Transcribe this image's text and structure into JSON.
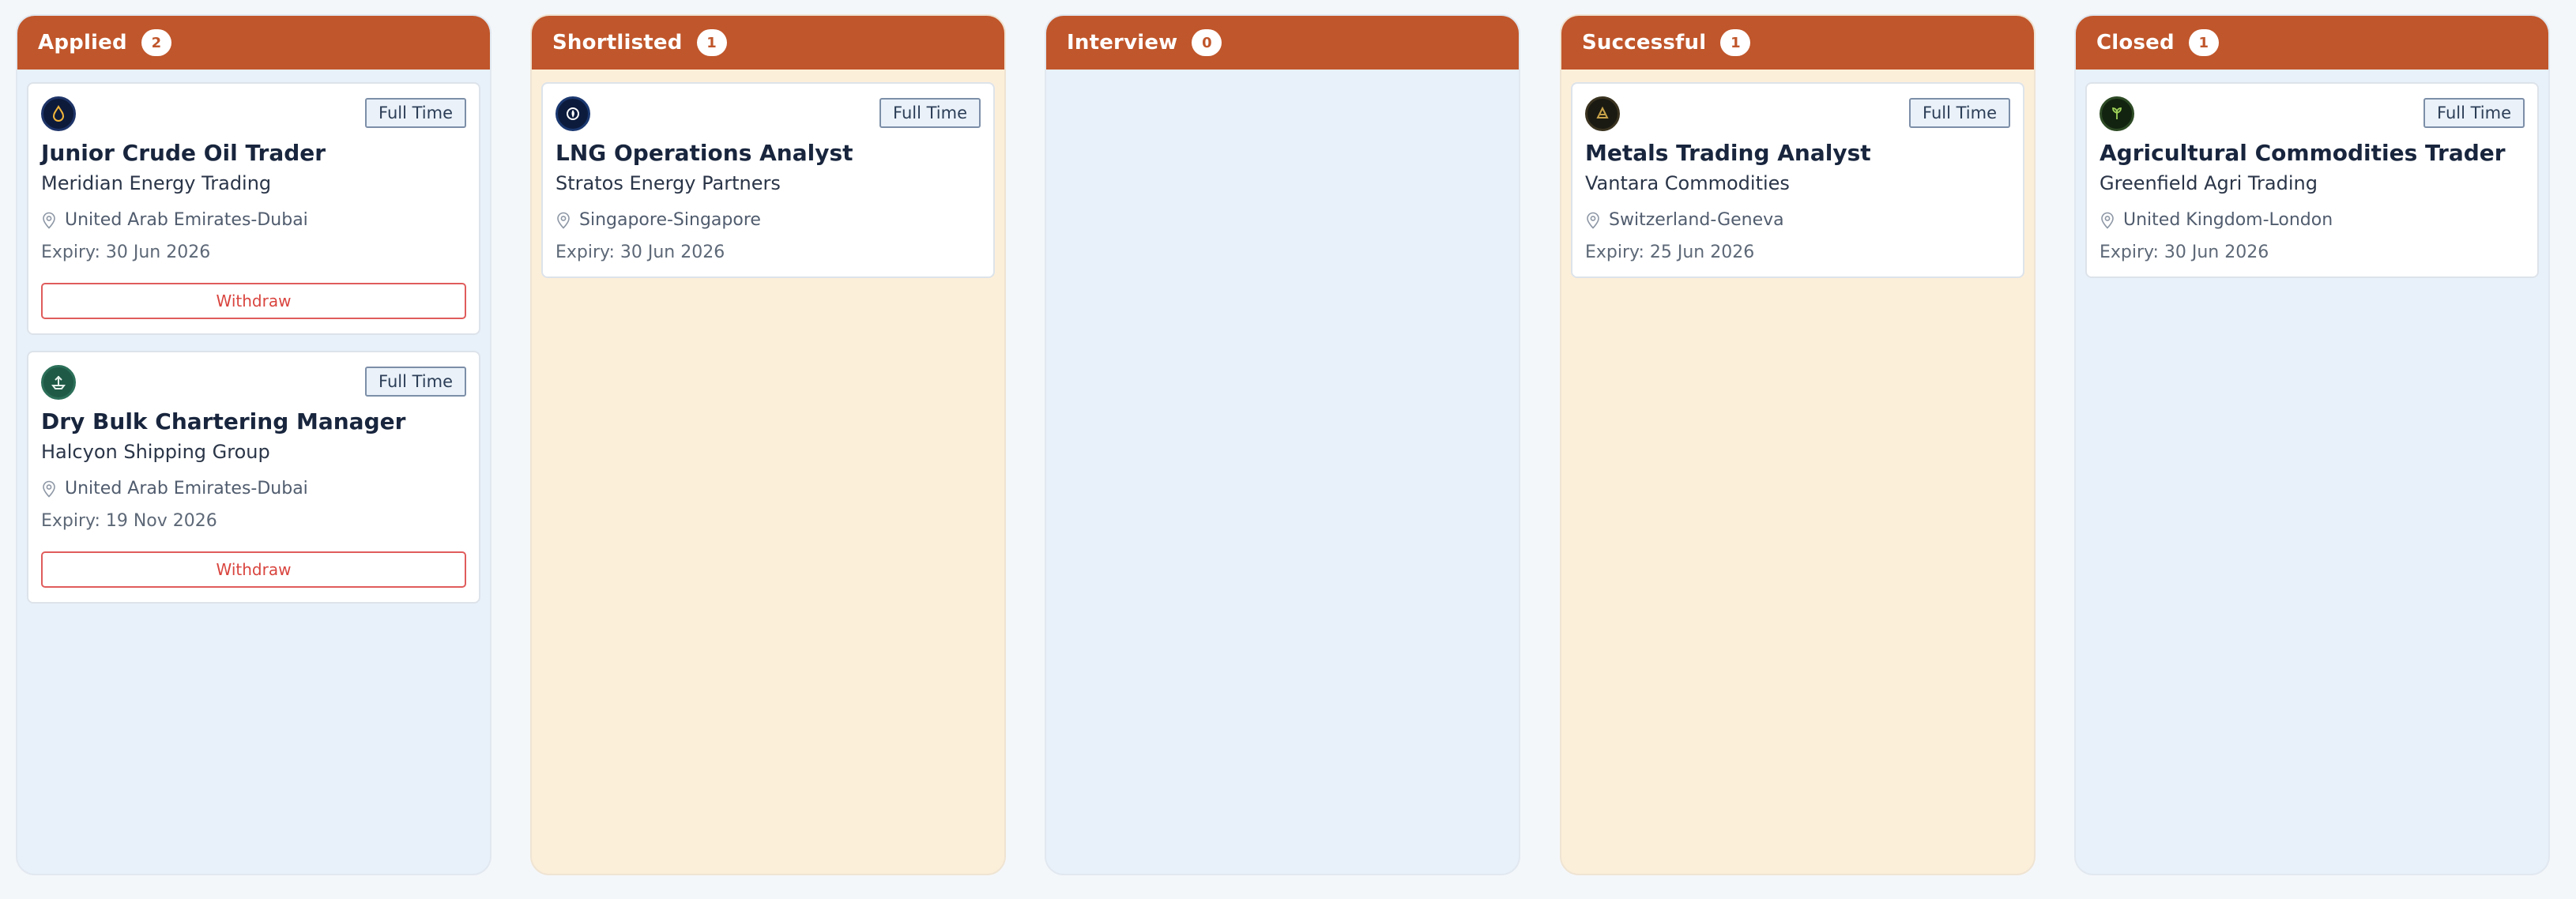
{
  "columns": [
    {
      "title": "Applied",
      "count": "2",
      "theme": "blue",
      "cards": [
        {
          "logo_icon": "oil-flame-logo",
          "tag": "Full Time",
          "title": "Junior Crude Oil Trader",
          "company": "Meridian Energy Trading",
          "location": "United Arab Emirates-Dubai",
          "expiry": "Expiry: 30 Jun 2026",
          "action": "Withdraw"
        },
        {
          "logo_icon": "ship-logo",
          "tag": "Full Time",
          "title": "Dry Bulk Chartering Manager",
          "company": "Halcyon Shipping Group",
          "location": "United Arab Emirates-Dubai",
          "expiry": "Expiry: 19 Nov 2026",
          "action": "Withdraw"
        }
      ]
    },
    {
      "title": "Shortlisted",
      "count": "1",
      "theme": "cream",
      "cards": [
        {
          "logo_icon": "gas-logo",
          "tag": "Full Time",
          "title": "LNG Operations Analyst",
          "company": "Stratos Energy Partners",
          "location": "Singapore-Singapore",
          "expiry": "Expiry: 30 Jun 2026"
        }
      ]
    },
    {
      "title": "Interview",
      "count": "0",
      "theme": "blue",
      "cards": []
    },
    {
      "title": "Successful",
      "count": "1",
      "theme": "cream",
      "cards": [
        {
          "logo_icon": "metals-logo",
          "tag": "Full Time",
          "title": "Metals Trading Analyst",
          "company": "Vantara Commodities",
          "location": "Switzerland-Geneva",
          "expiry": "Expiry: 25 Jun 2026"
        }
      ]
    },
    {
      "title": "Closed",
      "count": "1",
      "theme": "blue",
      "cards": [
        {
          "logo_icon": "agri-logo",
          "tag": "Full Time",
          "title": "Agricultural Commodities Trader",
          "company": "Greenfield Agri Trading",
          "location": "United Kingdom-London",
          "expiry": "Expiry: 30 Jun 2026"
        }
      ]
    }
  ],
  "colors": {
    "header": "#c0562b",
    "blue_column": "#e8f0f9",
    "cream_column": "#fcefd9",
    "withdraw": "#d9453f"
  }
}
